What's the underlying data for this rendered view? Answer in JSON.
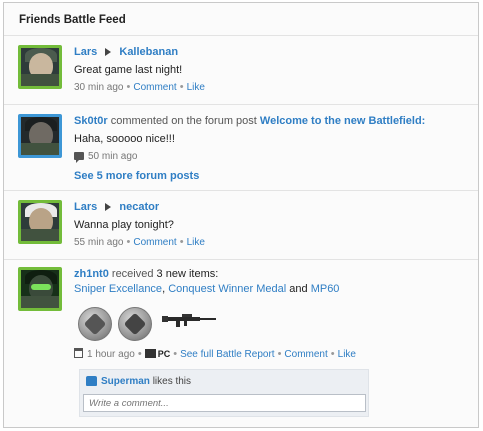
{
  "panel": {
    "title": "Friends Battle Feed"
  },
  "feed": {
    "item1": {
      "from": "Lars",
      "to": "Kallebanan",
      "message": "Great game last night!",
      "time": "30 min ago",
      "comment": "Comment",
      "like": "Like"
    },
    "item2": {
      "user": "Sk0t0r",
      "action": "commented on the forum post",
      "post": "Welcome to the new Battlefield:",
      "message": "Haha, sooooo nice!!!",
      "time": "50 min ago",
      "more": "See 5 more forum posts"
    },
    "item3": {
      "from": "Lars",
      "to": "necator",
      "message": "Wanna play tonight?",
      "time": "55 min ago",
      "comment": "Comment",
      "like": "Like"
    },
    "item4": {
      "user": "zh1nt0",
      "action": "received",
      "count": "3 new items:",
      "items": [
        "Sniper Excellance",
        "Conquest Winner Medal",
        "MP60"
      ],
      "sep1": ",",
      "and": "and",
      "time": "1 hour ago",
      "platform": "PC",
      "report": "See full Battle Report",
      "comment": "Comment",
      "like": "Like",
      "liker": "Superman",
      "likes_this": "likes this",
      "comment_placeholder": "Write a comment..."
    }
  },
  "colors": {
    "accent": "#2f7ec4",
    "avatar_green": "#73bc3a",
    "avatar_blue": "#3d97d6"
  },
  "icons": [
    "arrow-right-icon",
    "comment-icon",
    "calendar-icon",
    "pc-icon",
    "thumbs-up-icon"
  ]
}
